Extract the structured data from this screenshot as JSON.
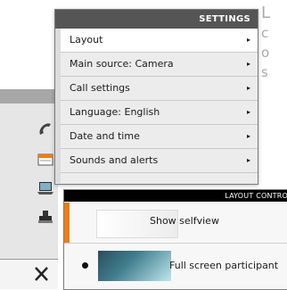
{
  "background_text": {
    "letter1": "L",
    "letter2": "c",
    "letter3": "o",
    "letter4": "s"
  },
  "settings": {
    "title": "SETTINGS",
    "items": [
      {
        "label": "Layout",
        "active": true
      },
      {
        "label": "Main source: Camera"
      },
      {
        "label": "Call settings"
      },
      {
        "label": "Language: English"
      },
      {
        "label": "Date and time"
      },
      {
        "label": "Sounds and alerts"
      }
    ],
    "arrow_glyph": "▸"
  },
  "layout_control": {
    "title": "LAYOUT CONTRO",
    "options": [
      {
        "label": "Show selfview"
      },
      {
        "label": "Full screen participant",
        "selected": true
      }
    ]
  },
  "left_icons": [
    "phone-icon",
    "calendar-icon",
    "laptop-icon",
    "stamp-icon",
    "tools-icon"
  ],
  "colors": {
    "accent_orange": "#ef7d12",
    "header_dark": "#555555"
  }
}
